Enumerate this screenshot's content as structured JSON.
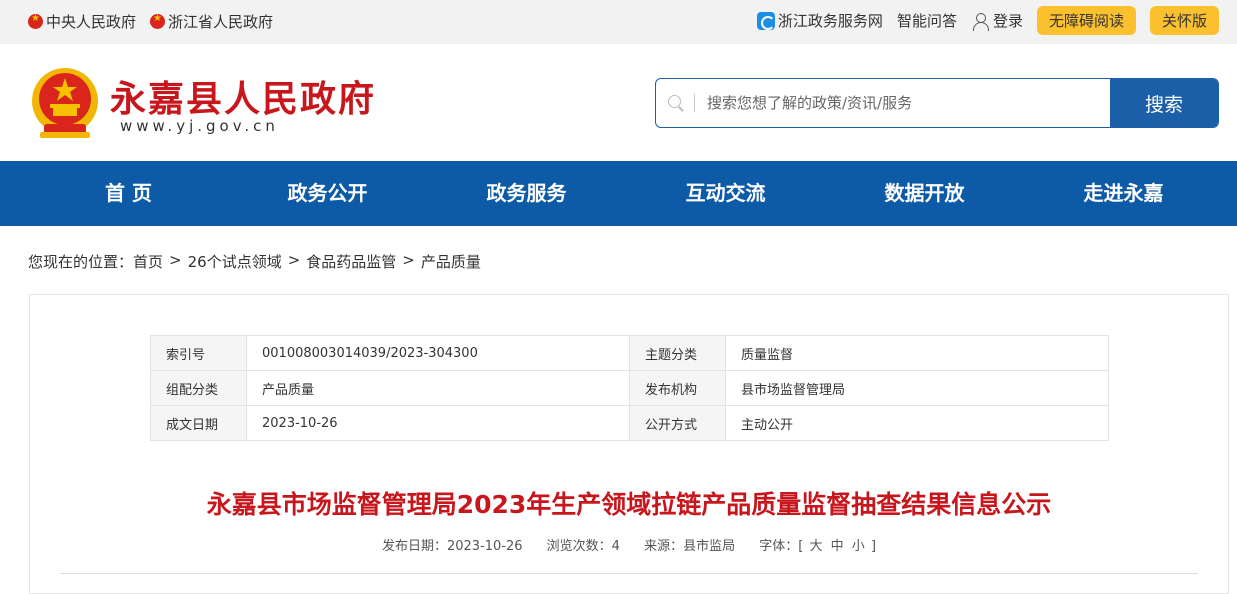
{
  "topbar": {
    "left_links": [
      "中央人民政府",
      "浙江省人民政府"
    ],
    "zjzw": "浙江政务服务网",
    "qa": "智能问答",
    "login": "登录",
    "accessible": "无障碍阅读",
    "elder": "关怀版"
  },
  "header": {
    "title": "永嘉县人民政府",
    "url": "www.yj.gov.cn",
    "search_placeholder": "搜索您想了解的政策/资讯/服务",
    "search_button": "搜索"
  },
  "nav": [
    "首 页",
    "政务公开",
    "政务服务",
    "互动交流",
    "数据开放",
    "走进永嘉"
  ],
  "breadcrumb": {
    "prefix": "您现在的位置：",
    "items": [
      "首页",
      "26个试点领域",
      "食品药品监管",
      "产品质量"
    ]
  },
  "meta": {
    "index_label": "索引号",
    "index_value": "001008003014039/2023-304300",
    "topic_label": "主题分类",
    "topic_value": "质量监督",
    "group_label": "组配分类",
    "group_value": "产品质量",
    "org_label": "发布机构",
    "org_value": "县市场监督管理局",
    "date_label": "成文日期",
    "date_value": "2023-10-26",
    "open_label": "公开方式",
    "open_value": "主动公开"
  },
  "article": {
    "title": "永嘉县市场监督管理局2023年生产领域拉链产品质量监督抽查结果信息公示",
    "publish": "发布日期：2023-10-26",
    "views": "浏览次数：4",
    "source": "来源：县市监局",
    "font_label": "字体：[",
    "font_big": "大",
    "font_mid": "中",
    "font_small": "小",
    "font_end": "]"
  }
}
